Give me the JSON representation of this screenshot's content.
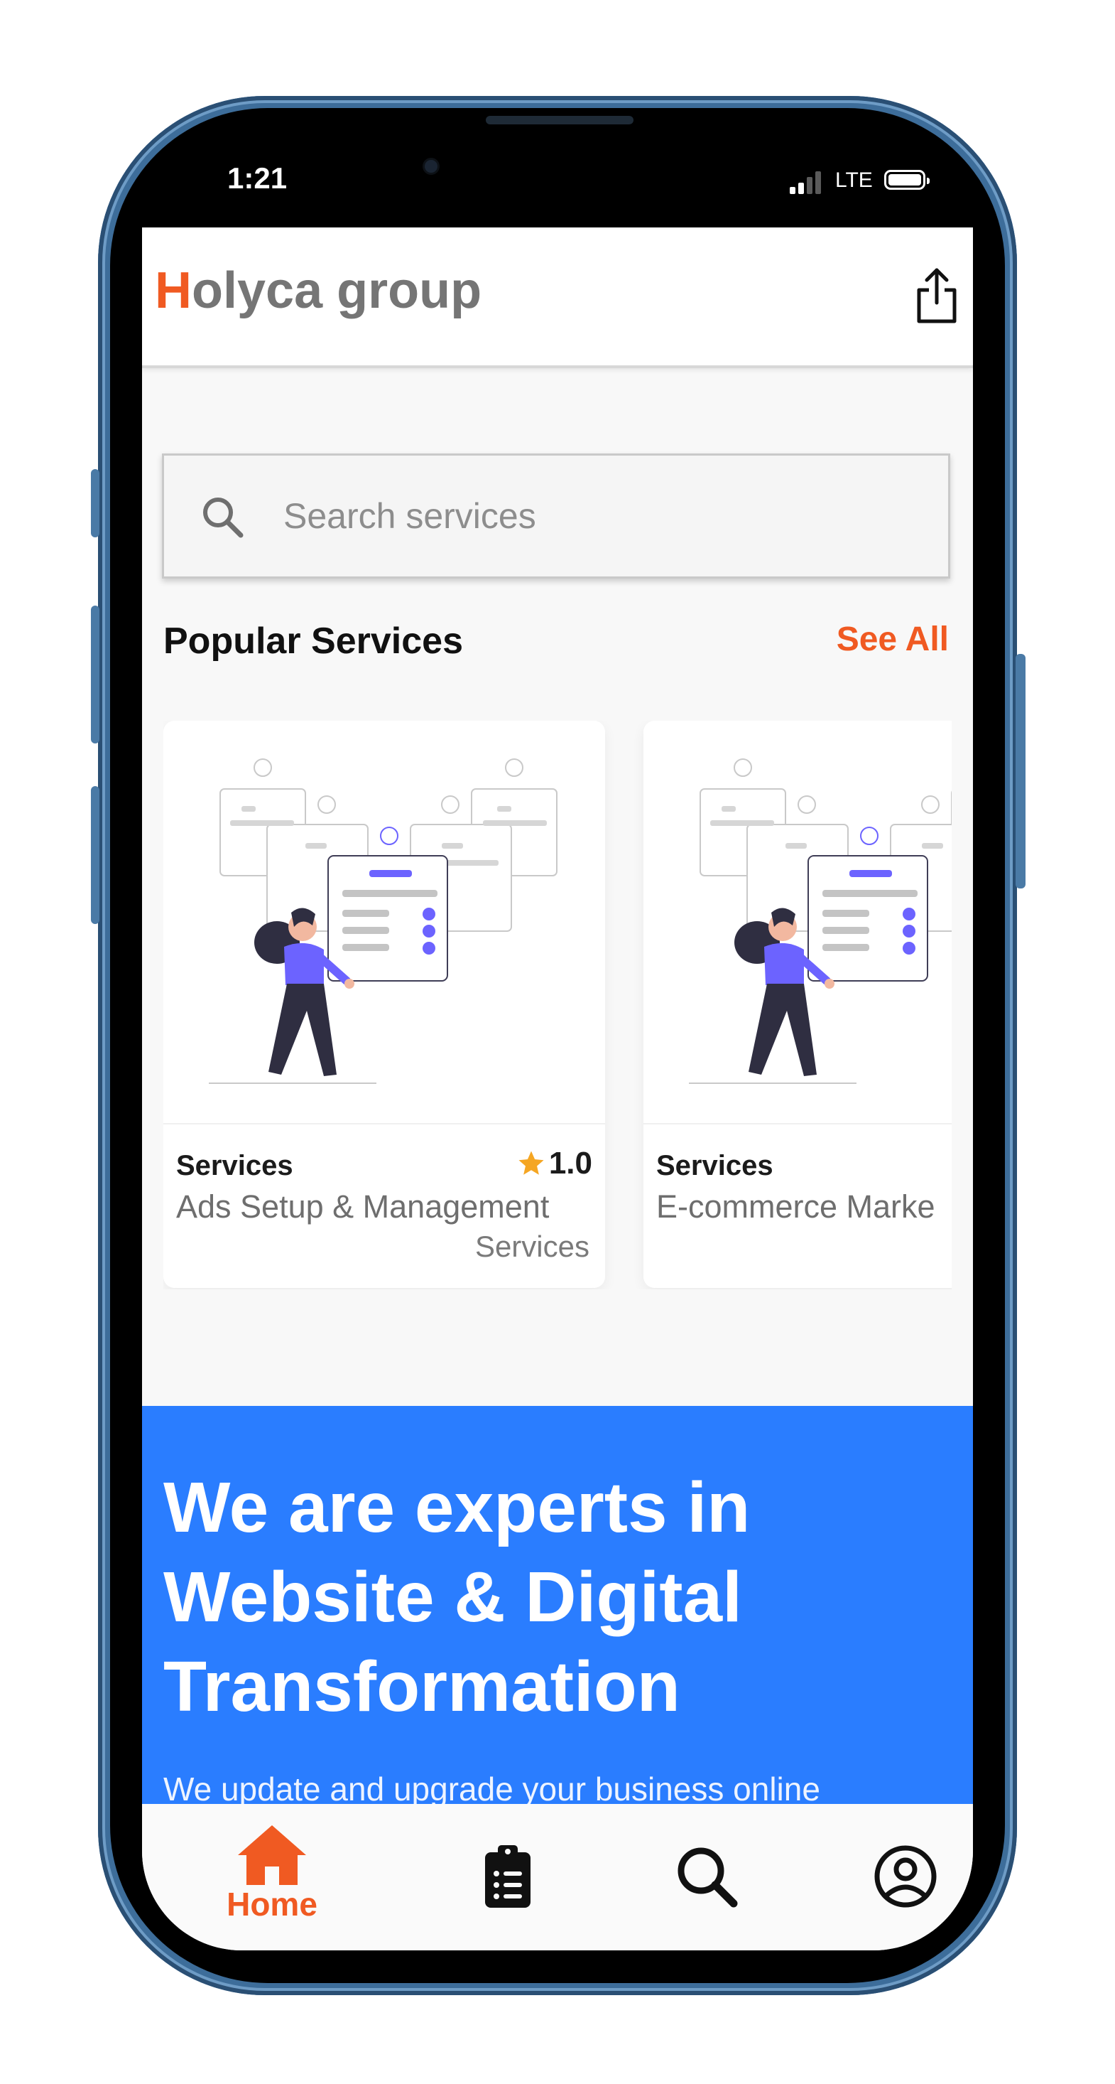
{
  "status_bar": {
    "time": "1:21",
    "network": "LTE"
  },
  "header": {
    "brand_first_letter": "H",
    "brand_rest": "olyca group",
    "brand_accent_color": "#f05a22",
    "share_icon": "share-icon"
  },
  "search": {
    "placeholder": "Search services",
    "value": ""
  },
  "popular": {
    "title": "Popular Services",
    "see_all": "See All",
    "cards": [
      {
        "category": "Services",
        "name": "Ads Setup & Management",
        "tag": "Services",
        "rating": "1.0"
      },
      {
        "category": "Services",
        "name": "E-commerce Marke"
      }
    ]
  },
  "hero": {
    "title": "We are experts in Website & Digital Transformation",
    "subtitle": "We update and upgrade your business online",
    "background_color": "#2a7dff"
  },
  "bottom_nav": {
    "items": [
      {
        "label": "Home",
        "icon": "home-icon",
        "active": true
      },
      {
        "label": "",
        "icon": "clipboard-list-icon"
      },
      {
        "label": "",
        "icon": "search-icon"
      },
      {
        "label": "",
        "icon": "account-icon"
      }
    ]
  }
}
